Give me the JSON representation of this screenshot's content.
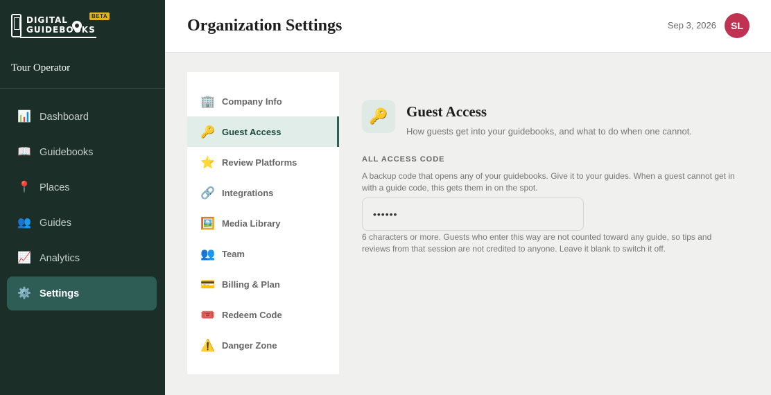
{
  "brand": {
    "name_line1": "DIGITAL",
    "name_line2": "GUIDEBOOKS",
    "badge": "BETA"
  },
  "organization": "Tour Operator",
  "nav": [
    {
      "icon": "📊",
      "icon_name": "bar-chart-icon",
      "label": "Dashboard"
    },
    {
      "icon": "📖",
      "icon_name": "book-icon",
      "label": "Guidebooks"
    },
    {
      "icon": "📍",
      "icon_name": "pin-icon",
      "label": "Places"
    },
    {
      "icon": "👥",
      "icon_name": "people-icon",
      "label": "Guides"
    },
    {
      "icon": "📈",
      "icon_name": "trend-chart-icon",
      "label": "Analytics"
    },
    {
      "icon": "⚙️",
      "icon_name": "gear-icon",
      "label": "Settings",
      "active": true
    }
  ],
  "header": {
    "title": "Organization Settings",
    "date": "Sep 3, 2026",
    "avatar_initials": "SL"
  },
  "settings_menu": [
    {
      "icon": "🏢",
      "icon_name": "building-icon",
      "label": "Company Info"
    },
    {
      "icon": "🔑",
      "icon_name": "key-icon",
      "label": "Guest Access",
      "active": true
    },
    {
      "icon": "⭐",
      "icon_name": "star-icon",
      "label": "Review Platforms"
    },
    {
      "icon": "🔗",
      "icon_name": "link-icon",
      "label": "Integrations"
    },
    {
      "icon": "🖼️",
      "icon_name": "image-icon",
      "label": "Media Library"
    },
    {
      "icon": "👥",
      "icon_name": "team-icon",
      "label": "Team"
    },
    {
      "icon": "💳",
      "icon_name": "credit-card-icon",
      "label": "Billing & Plan"
    },
    {
      "icon": "🎟️",
      "icon_name": "ticket-icon",
      "label": "Redeem Code"
    },
    {
      "icon": "⚠️",
      "icon_name": "warning-icon",
      "label": "Danger Zone"
    }
  ],
  "section": {
    "icon": "🔑",
    "title": "Guest Access",
    "subtitle": "How guests get into your guidebooks, and what to do when one cannot.",
    "field_label": "ALL ACCESS CODE",
    "field_description": "A backup code that opens any of your guidebooks. Give it to your guides. When a guest cannot get in with a guide code, this gets them in on the spot.",
    "field_value": "••••••",
    "field_hint": "6 characters or more. Guests who enter this way are not counted toward any guide, so tips and reviews from that session are not credited to anyone. Leave it blank to switch it off."
  },
  "colors": {
    "sidebar": "#1b2e28",
    "accent": "#2e5d55",
    "avatar": "#bf3252",
    "beta": "#e3b31d"
  }
}
